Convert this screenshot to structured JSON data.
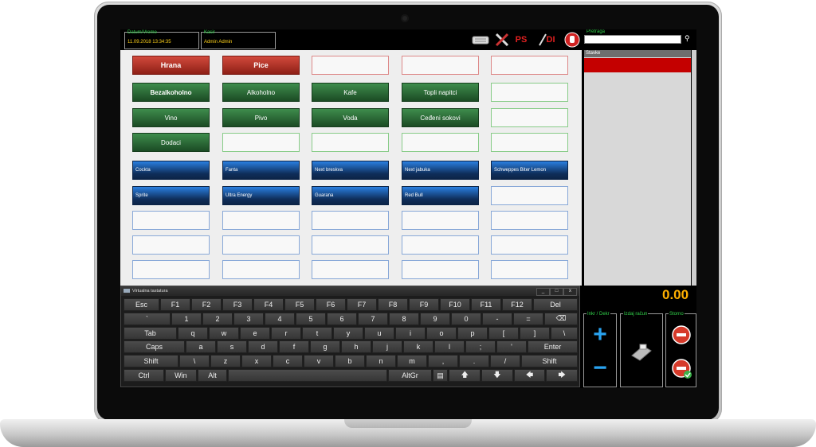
{
  "topbar": {
    "datetime_label": "Datum/Vreme",
    "datetime_value": "11.09.2018 13:34:35",
    "cashier_label": "Kasir",
    "cashier_value": "Admin Admin",
    "ps_label": "PS",
    "di_label": "DI",
    "search_label": "Pretraga",
    "search_value": ""
  },
  "categories": [
    {
      "label": "Hrana",
      "style": "red"
    },
    {
      "label": "Pice",
      "style": "red"
    },
    {
      "label": "Bezalkoholno",
      "style": "green"
    },
    {
      "label": "Alkoholno",
      "style": "green"
    },
    {
      "label": "Kafe",
      "style": "green"
    },
    {
      "label": "Topli napitci",
      "style": "green"
    },
    {
      "label": "Vino",
      "style": "green"
    },
    {
      "label": "Pivo",
      "style": "green"
    },
    {
      "label": "Voda",
      "style": "green"
    },
    {
      "label": "Ceđeni sokovi",
      "style": "green"
    },
    {
      "label": "Dodaci",
      "style": "green"
    }
  ],
  "products": [
    "Cockta",
    "Fanta",
    "Next breskva",
    "Next jabuka",
    "Schweppes Biter Lemon",
    "Sprite",
    "Ultra Energy",
    "Guarana",
    "Red Bull"
  ],
  "stavke": {
    "header": "Stavke"
  },
  "total": "0.00",
  "keyboard": {
    "title": "Virtualna tastatura",
    "controls": [
      "_",
      "□",
      "x"
    ],
    "rows": [
      [
        "Esc",
        "F1",
        "F2",
        "F3",
        "F4",
        "F5",
        "F6",
        "F7",
        "F8",
        "F9",
        "F10",
        "F11",
        "F12",
        "Del"
      ],
      [
        "`",
        "1",
        "2",
        "3",
        "4",
        "5",
        "6",
        "7",
        "8",
        "9",
        "0",
        "-",
        "=",
        "⌫"
      ],
      [
        "Tab",
        "q",
        "w",
        "e",
        "r",
        "t",
        "y",
        "u",
        "i",
        "o",
        "p",
        "[",
        "]",
        "\\"
      ],
      [
        "Caps",
        "a",
        "s",
        "d",
        "f",
        "g",
        "h",
        "j",
        "k",
        "l",
        ";",
        "'",
        "Enter"
      ],
      [
        "Shift",
        "\\",
        "z",
        "x",
        "c",
        "v",
        "b",
        "n",
        "m",
        ",",
        ".",
        "/",
        "Shift"
      ],
      [
        "Ctrl",
        "Win",
        "Alt",
        "",
        "AltGr",
        "▤",
        "🡅",
        "🡇",
        "🡄",
        "🡆"
      ]
    ]
  },
  "actions": {
    "inc_label": "Inkr / Dekr",
    "receipt_label": "Izdaj račun",
    "storno_label": "Storno",
    "plus_symbol": "+",
    "minus_symbol": "−"
  },
  "colors": {
    "accent_green": "#31d24a",
    "accent_yellow": "#ffd21a",
    "total_color": "#ffb000",
    "stavke_selected": "#c40000"
  }
}
